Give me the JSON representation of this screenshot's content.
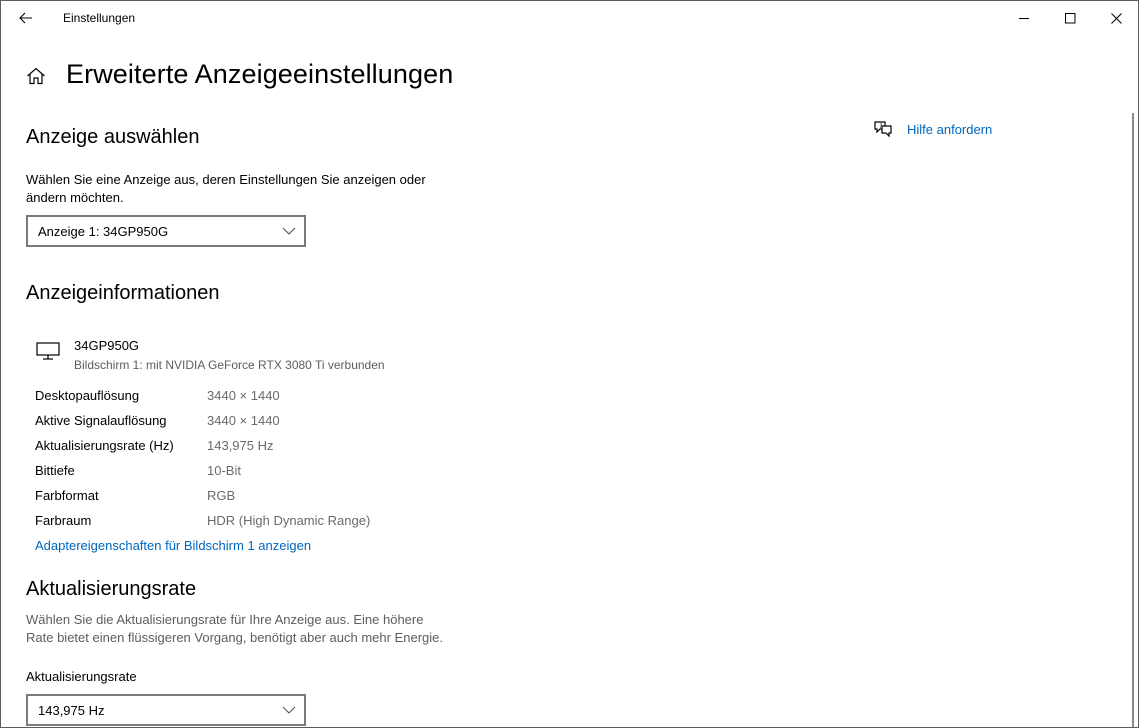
{
  "window": {
    "app_title": "Einstellungen"
  },
  "header": {
    "title": "Erweiterte Anzeigeeinstellungen"
  },
  "help": {
    "label": "Hilfe anfordern"
  },
  "select_display": {
    "heading": "Anzeige auswählen",
    "description_line1": "Wählen Sie eine Anzeige aus, deren Einstellungen Sie anzeigen oder",
    "description_line2": "ändern möchten.",
    "selected": "Anzeige 1: 34GP950G"
  },
  "display_info": {
    "heading": "Anzeigeinformationen",
    "display_name": "34GP950G",
    "display_sub": "Bildschirm 1: mit NVIDIA GeForce RTX 3080 Ti verbunden",
    "rows": [
      {
        "label": "Desktopauflösung",
        "value": "3440 × 1440"
      },
      {
        "label": "Aktive Signalauflösung",
        "value": "3440 × 1440"
      },
      {
        "label": "Aktualisierungsrate (Hz)",
        "value": "143,975 Hz"
      },
      {
        "label": "Bittiefe",
        "value": "10-Bit"
      },
      {
        "label": "Farbformat",
        "value": "RGB"
      },
      {
        "label": "Farbraum",
        "value": "HDR (High Dynamic Range)"
      }
    ],
    "adapter_link": "Adaptereigenschaften für Bildschirm 1 anzeigen"
  },
  "refresh_rate": {
    "heading": "Aktualisierungsrate",
    "description_line1": "Wählen Sie die Aktualisierungsrate für Ihre Anzeige aus. Eine höhere",
    "description_line2": "Rate bietet einen flüssigeren Vorgang, benötigt aber auch mehr Energie.",
    "field_label": "Aktualisierungsrate",
    "selected": "143,975 Hz"
  },
  "icons": {
    "back": "back-arrow-icon",
    "home": "home-icon",
    "help": "chat-help-icon",
    "monitor": "monitor-icon",
    "chevron": "chevron-down-icon"
  },
  "colors": {
    "accent_link": "#0067c0",
    "muted_text": "#5d5d5d"
  }
}
